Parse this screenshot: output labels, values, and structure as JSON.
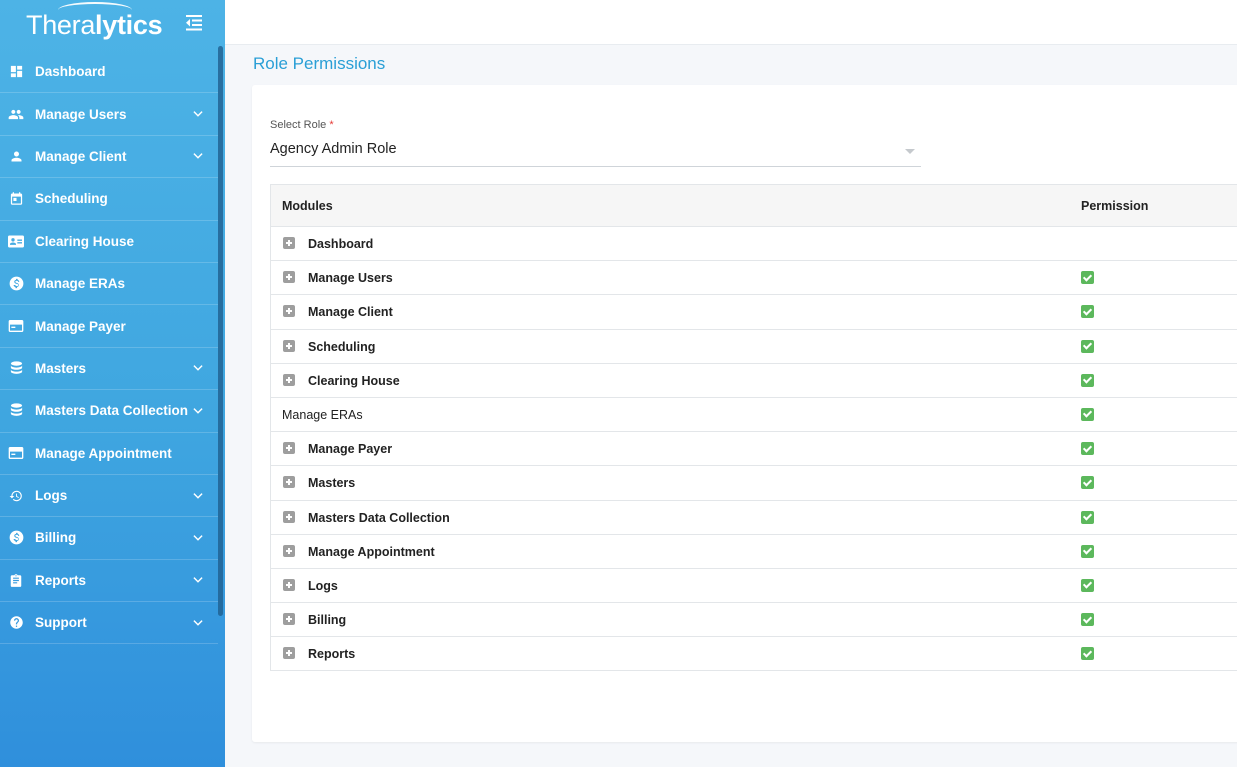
{
  "app": {
    "logo_light": "Thera",
    "logo_bold": "lytics"
  },
  "sidebar": {
    "items": [
      {
        "label": "Dashboard",
        "icon": "dashboard-icon",
        "chevron": false
      },
      {
        "label": "Manage Users",
        "icon": "users-icon",
        "chevron": true
      },
      {
        "label": "Manage Client",
        "icon": "person-icon",
        "chevron": true
      },
      {
        "label": "Scheduling",
        "icon": "calendar-icon",
        "chevron": false
      },
      {
        "label": "Clearing House",
        "icon": "id-card-icon",
        "chevron": false
      },
      {
        "label": "Manage ERAs",
        "icon": "dollar-icon",
        "chevron": false
      },
      {
        "label": "Manage Payer",
        "icon": "card-icon",
        "chevron": false
      },
      {
        "label": "Masters",
        "icon": "database-icon",
        "chevron": true
      },
      {
        "label": "Masters Data Collection",
        "icon": "database-icon",
        "chevron": true
      },
      {
        "label": "Manage Appointment",
        "icon": "card-icon",
        "chevron": false
      },
      {
        "label": "Logs",
        "icon": "history-icon",
        "chevron": true
      },
      {
        "label": "Billing",
        "icon": "dollar-icon",
        "chevron": true
      },
      {
        "label": "Reports",
        "icon": "clipboard-icon",
        "chevron": true
      },
      {
        "label": "Support",
        "icon": "help-icon",
        "chevron": true
      }
    ]
  },
  "page": {
    "title": "Role Permissions"
  },
  "role_select": {
    "label": "Select Role",
    "required_mark": "*",
    "value": "Agency Admin Role"
  },
  "table": {
    "headers": {
      "modules": "Modules",
      "permission": "Permission"
    },
    "rows": [
      {
        "name": "Dashboard",
        "expandable": true,
        "checked": false
      },
      {
        "name": "Manage Users",
        "expandable": true,
        "checked": true
      },
      {
        "name": "Manage Client",
        "expandable": true,
        "checked": true
      },
      {
        "name": "Scheduling",
        "expandable": true,
        "checked": true
      },
      {
        "name": "Clearing House",
        "expandable": true,
        "checked": true
      },
      {
        "name": "Manage ERAs",
        "expandable": false,
        "checked": true
      },
      {
        "name": "Manage Payer",
        "expandable": true,
        "checked": true
      },
      {
        "name": "Masters",
        "expandable": true,
        "checked": true
      },
      {
        "name": "Masters Data Collection",
        "expandable": true,
        "checked": true
      },
      {
        "name": "Manage Appointment",
        "expandable": true,
        "checked": true
      },
      {
        "name": "Logs",
        "expandable": true,
        "checked": true
      },
      {
        "name": "Billing",
        "expandable": true,
        "checked": true
      },
      {
        "name": "Reports",
        "expandable": true,
        "checked": true
      }
    ]
  },
  "colors": {
    "accent": "#2a9fd6",
    "sidebar_top": "#4db3e6",
    "sidebar_bottom": "#2f8fdc",
    "check_green": "#5cb85c"
  }
}
